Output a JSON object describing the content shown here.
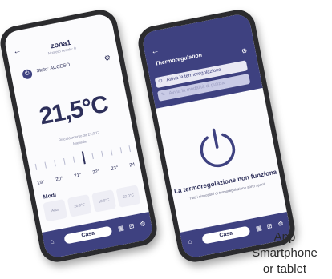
{
  "left_screen": {
    "zone_title": "zona1",
    "zone_subtitle": "Numero seriale: 0",
    "state": "Stato: ACCESO",
    "temperature": "21,5°C",
    "setpoint": "Riscaldamento da 21,0°C",
    "mode": "Manuale",
    "scale": [
      "19°",
      "20°",
      "21°",
      "22°",
      "23°",
      "24"
    ],
    "modes_label": "Modi",
    "mode_chips": [
      "Auto",
      "20,0°C",
      "10,0°C",
      "22,0°C"
    ],
    "nav_label": "Casa"
  },
  "right_screen": {
    "title": "Thermoregulation",
    "activate_button": "Attiva la termoregolazione",
    "party_button": "Avvia la modalità di pulizia",
    "message_title": "La termoregolazione non funziona",
    "message_sub": "Tutti i dispositivi di termoregolazione sono spenti",
    "nav_label": "Casa"
  },
  "caption": {
    "line1": "App",
    "line2": "Smartphone",
    "line3": "or tablet"
  },
  "colors": {
    "brand": "#3e4180",
    "text": "#2d2f5a"
  }
}
